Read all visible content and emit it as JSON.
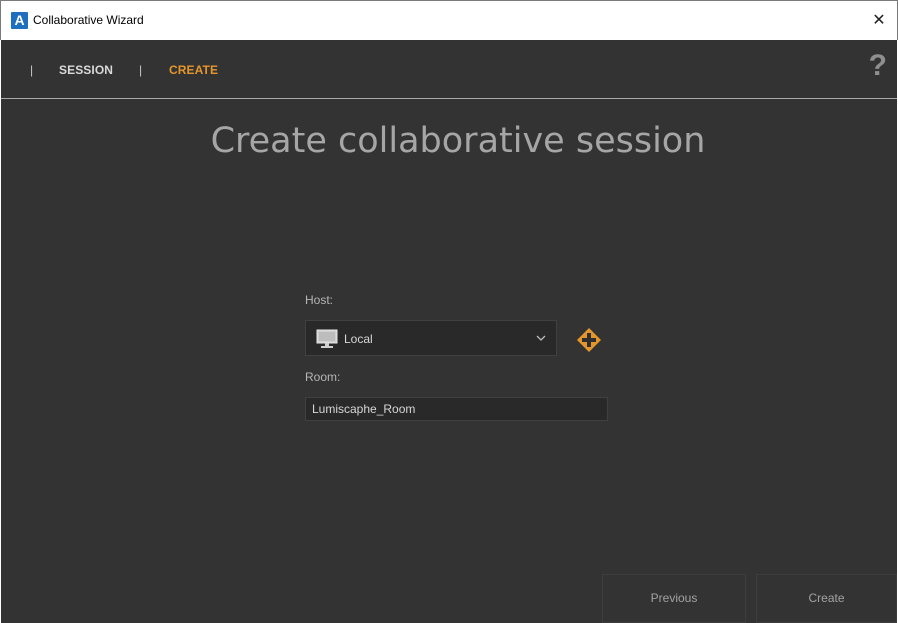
{
  "window": {
    "app_logo_letter": "A",
    "title": "Collaborative Wizard",
    "close_glyph": "✕"
  },
  "nav": {
    "separator": "|",
    "items": [
      {
        "label": "SESSION",
        "active": false
      },
      {
        "label": "CREATE",
        "active": true
      }
    ],
    "help_label": "?"
  },
  "page": {
    "heading": "Create collaborative session"
  },
  "form": {
    "host_label": "Host:",
    "host_value": "Local",
    "host_icon": "monitor-icon",
    "room_label": "Room:",
    "room_value": "Lumiscaphe_Room",
    "add_host_icon": "add-plus-icon"
  },
  "footer": {
    "previous_label": "Previous",
    "create_label": "Create"
  },
  "colors": {
    "background": "#333333",
    "accent": "#e5962b",
    "title_bar": "#ffffff",
    "field_background": "#292929"
  }
}
